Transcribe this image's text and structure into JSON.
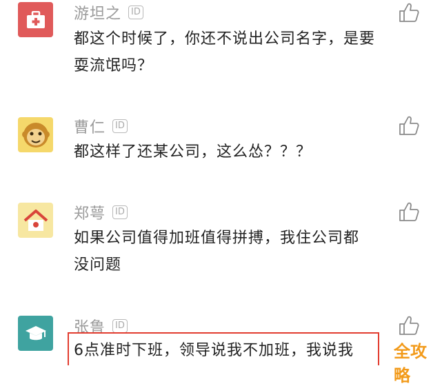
{
  "comments": [
    {
      "name": "游坦之",
      "id_badge": "ID",
      "text": "都这个时候了，你还不说出公司名字，是要耍流氓吗？",
      "avatar_icon": "medical-case-icon",
      "avatar_color": "#e05a5a"
    },
    {
      "name": "曹仁",
      "id_badge": "ID",
      "text": "都这样了还某公司，这么怂？？？",
      "avatar_icon": "monkey-face-icon",
      "avatar_color": "#f5d86b"
    },
    {
      "name": "郑萼",
      "id_badge": "ID",
      "text": "如果公司值得加班值得拼搏，我住公司都没问题",
      "avatar_icon": "house-icon",
      "avatar_color": "#f7e7a1"
    },
    {
      "name": "张鲁",
      "id_badge": "ID",
      "text": "6点准时下班，领导说我不加班，我说我",
      "avatar_icon": "graduation-cap-icon",
      "avatar_color": "#3fa3a0"
    }
  ],
  "like_icon": "thumbs-up-icon",
  "watermark": "全攻略",
  "colors": {
    "name_gray": "#9a9a9a",
    "text": "#222222",
    "highlight_border": "#e23b2e",
    "watermark": "#f29a1a"
  }
}
